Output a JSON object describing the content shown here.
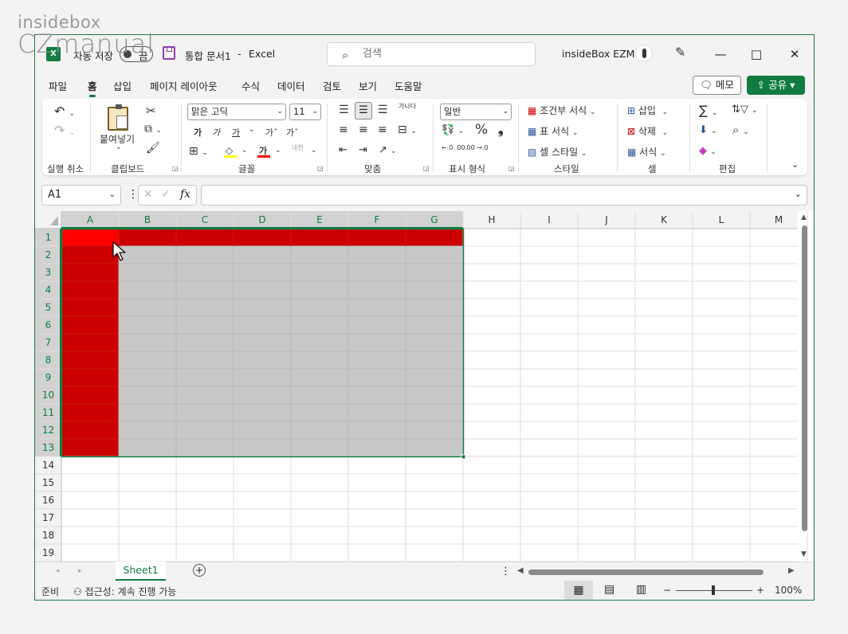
{
  "watermark": {
    "line1": "insidebox",
    "line2": "CZmanual"
  },
  "titlebar": {
    "app_icon": "X",
    "autosave_label": "자동 저장",
    "autosave_state": "끔",
    "save_icon": "save-icon",
    "doc_title": "통합 문서1",
    "separator": "-",
    "app_name": "Excel",
    "search_placeholder": "검색",
    "user_name": "insideBox EZM",
    "min": "—",
    "max": "□",
    "close": "✕"
  },
  "menu": {
    "tabs": [
      "파일",
      "홈",
      "삽입",
      "페이지 레이아웃",
      "수식",
      "데이터",
      "검토",
      "보기",
      "도움말"
    ],
    "active": "홈",
    "memo": "메모",
    "share": "공유"
  },
  "ribbon": {
    "groups": {
      "undo": "실행 취소",
      "clipboard": "클립보드",
      "font": "글꼴",
      "align": "맞춤",
      "number": "표시 형식",
      "style": "스타일",
      "cells": "셀",
      "edit": "편집"
    },
    "paste": "붙여넣기",
    "font_name": "맑은 고딕",
    "font_size": "11",
    "bold": "가",
    "italic": "가",
    "underline": "가",
    "grow": "가ˆ",
    "shrink": "가ˇ",
    "font_color": "가",
    "phonetic": "내천",
    "wrap": "가나다",
    "number_format": "일반",
    "percent": "%",
    "comma": "❟",
    "dec_inc": "←.0 .00",
    "dec_dec": ".00 →.0",
    "cond_format": "조건부 서식",
    "table_format": "표 서식",
    "cell_style": "셀 스타일",
    "insert": "삽입",
    "delete": "삭제",
    "format": "서식",
    "sum": "∑"
  },
  "formula": {
    "name_box": "A1",
    "fx": "fx",
    "value": ""
  },
  "grid": {
    "columns": [
      "A",
      "B",
      "C",
      "D",
      "E",
      "F",
      "G",
      "H",
      "I",
      "J",
      "K",
      "L",
      "M"
    ],
    "rows": [
      "1",
      "2",
      "3",
      "4",
      "5",
      "6",
      "7",
      "8",
      "9",
      "10",
      "11",
      "12",
      "13",
      "14",
      "15",
      "16",
      "17",
      "18",
      "19"
    ],
    "active_cell": "A1",
    "selection": "A1:G13",
    "red_fill": "#cc0000",
    "active_red": "#ff0000",
    "gray_fill": "#c8c8c8",
    "accent": "#107c41"
  },
  "sheets": {
    "tabs": [
      "Sheet1"
    ],
    "active": "Sheet1"
  },
  "status": {
    "ready": "준비",
    "accessibility": "접근성: 계속 진행 가능",
    "zoom_minus": "−",
    "zoom_plus": "+",
    "zoom": "100%"
  }
}
